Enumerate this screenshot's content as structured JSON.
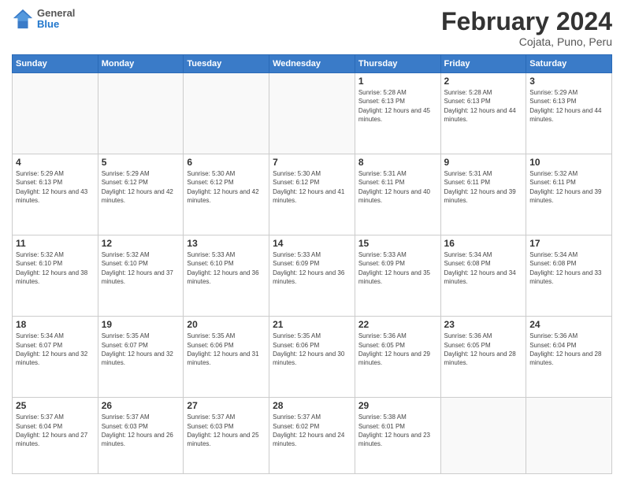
{
  "logo": {
    "general": "General",
    "blue": "Blue"
  },
  "header": {
    "month": "February 2024",
    "location": "Cojata, Puno, Peru"
  },
  "weekdays": [
    "Sunday",
    "Monday",
    "Tuesday",
    "Wednesday",
    "Thursday",
    "Friday",
    "Saturday"
  ],
  "weeks": [
    [
      {
        "day": "",
        "sunrise": "",
        "sunset": "",
        "daylight": "",
        "empty": true
      },
      {
        "day": "",
        "sunrise": "",
        "sunset": "",
        "daylight": "",
        "empty": true
      },
      {
        "day": "",
        "sunrise": "",
        "sunset": "",
        "daylight": "",
        "empty": true
      },
      {
        "day": "",
        "sunrise": "",
        "sunset": "",
        "daylight": "",
        "empty": true
      },
      {
        "day": "1",
        "sunrise": "Sunrise: 5:28 AM",
        "sunset": "Sunset: 6:13 PM",
        "daylight": "Daylight: 12 hours and 45 minutes."
      },
      {
        "day": "2",
        "sunrise": "Sunrise: 5:28 AM",
        "sunset": "Sunset: 6:13 PM",
        "daylight": "Daylight: 12 hours and 44 minutes."
      },
      {
        "day": "3",
        "sunrise": "Sunrise: 5:29 AM",
        "sunset": "Sunset: 6:13 PM",
        "daylight": "Daylight: 12 hours and 44 minutes."
      }
    ],
    [
      {
        "day": "4",
        "sunrise": "Sunrise: 5:29 AM",
        "sunset": "Sunset: 6:13 PM",
        "daylight": "Daylight: 12 hours and 43 minutes."
      },
      {
        "day": "5",
        "sunrise": "Sunrise: 5:29 AM",
        "sunset": "Sunset: 6:12 PM",
        "daylight": "Daylight: 12 hours and 42 minutes."
      },
      {
        "day": "6",
        "sunrise": "Sunrise: 5:30 AM",
        "sunset": "Sunset: 6:12 PM",
        "daylight": "Daylight: 12 hours and 42 minutes."
      },
      {
        "day": "7",
        "sunrise": "Sunrise: 5:30 AM",
        "sunset": "Sunset: 6:12 PM",
        "daylight": "Daylight: 12 hours and 41 minutes."
      },
      {
        "day": "8",
        "sunrise": "Sunrise: 5:31 AM",
        "sunset": "Sunset: 6:11 PM",
        "daylight": "Daylight: 12 hours and 40 minutes."
      },
      {
        "day": "9",
        "sunrise": "Sunrise: 5:31 AM",
        "sunset": "Sunset: 6:11 PM",
        "daylight": "Daylight: 12 hours and 39 minutes."
      },
      {
        "day": "10",
        "sunrise": "Sunrise: 5:32 AM",
        "sunset": "Sunset: 6:11 PM",
        "daylight": "Daylight: 12 hours and 39 minutes."
      }
    ],
    [
      {
        "day": "11",
        "sunrise": "Sunrise: 5:32 AM",
        "sunset": "Sunset: 6:10 PM",
        "daylight": "Daylight: 12 hours and 38 minutes."
      },
      {
        "day": "12",
        "sunrise": "Sunrise: 5:32 AM",
        "sunset": "Sunset: 6:10 PM",
        "daylight": "Daylight: 12 hours and 37 minutes."
      },
      {
        "day": "13",
        "sunrise": "Sunrise: 5:33 AM",
        "sunset": "Sunset: 6:10 PM",
        "daylight": "Daylight: 12 hours and 36 minutes."
      },
      {
        "day": "14",
        "sunrise": "Sunrise: 5:33 AM",
        "sunset": "Sunset: 6:09 PM",
        "daylight": "Daylight: 12 hours and 36 minutes."
      },
      {
        "day": "15",
        "sunrise": "Sunrise: 5:33 AM",
        "sunset": "Sunset: 6:09 PM",
        "daylight": "Daylight: 12 hours and 35 minutes."
      },
      {
        "day": "16",
        "sunrise": "Sunrise: 5:34 AM",
        "sunset": "Sunset: 6:08 PM",
        "daylight": "Daylight: 12 hours and 34 minutes."
      },
      {
        "day": "17",
        "sunrise": "Sunrise: 5:34 AM",
        "sunset": "Sunset: 6:08 PM",
        "daylight": "Daylight: 12 hours and 33 minutes."
      }
    ],
    [
      {
        "day": "18",
        "sunrise": "Sunrise: 5:34 AM",
        "sunset": "Sunset: 6:07 PM",
        "daylight": "Daylight: 12 hours and 32 minutes."
      },
      {
        "day": "19",
        "sunrise": "Sunrise: 5:35 AM",
        "sunset": "Sunset: 6:07 PM",
        "daylight": "Daylight: 12 hours and 32 minutes."
      },
      {
        "day": "20",
        "sunrise": "Sunrise: 5:35 AM",
        "sunset": "Sunset: 6:06 PM",
        "daylight": "Daylight: 12 hours and 31 minutes."
      },
      {
        "day": "21",
        "sunrise": "Sunrise: 5:35 AM",
        "sunset": "Sunset: 6:06 PM",
        "daylight": "Daylight: 12 hours and 30 minutes."
      },
      {
        "day": "22",
        "sunrise": "Sunrise: 5:36 AM",
        "sunset": "Sunset: 6:05 PM",
        "daylight": "Daylight: 12 hours and 29 minutes."
      },
      {
        "day": "23",
        "sunrise": "Sunrise: 5:36 AM",
        "sunset": "Sunset: 6:05 PM",
        "daylight": "Daylight: 12 hours and 28 minutes."
      },
      {
        "day": "24",
        "sunrise": "Sunrise: 5:36 AM",
        "sunset": "Sunset: 6:04 PM",
        "daylight": "Daylight: 12 hours and 28 minutes."
      }
    ],
    [
      {
        "day": "25",
        "sunrise": "Sunrise: 5:37 AM",
        "sunset": "Sunset: 6:04 PM",
        "daylight": "Daylight: 12 hours and 27 minutes."
      },
      {
        "day": "26",
        "sunrise": "Sunrise: 5:37 AM",
        "sunset": "Sunset: 6:03 PM",
        "daylight": "Daylight: 12 hours and 26 minutes."
      },
      {
        "day": "27",
        "sunrise": "Sunrise: 5:37 AM",
        "sunset": "Sunset: 6:03 PM",
        "daylight": "Daylight: 12 hours and 25 minutes."
      },
      {
        "day": "28",
        "sunrise": "Sunrise: 5:37 AM",
        "sunset": "Sunset: 6:02 PM",
        "daylight": "Daylight: 12 hours and 24 minutes."
      },
      {
        "day": "29",
        "sunrise": "Sunrise: 5:38 AM",
        "sunset": "Sunset: 6:01 PM",
        "daylight": "Daylight: 12 hours and 23 minutes."
      },
      {
        "day": "",
        "sunrise": "",
        "sunset": "",
        "daylight": "",
        "empty": true
      },
      {
        "day": "",
        "sunrise": "",
        "sunset": "",
        "daylight": "",
        "empty": true
      }
    ]
  ]
}
